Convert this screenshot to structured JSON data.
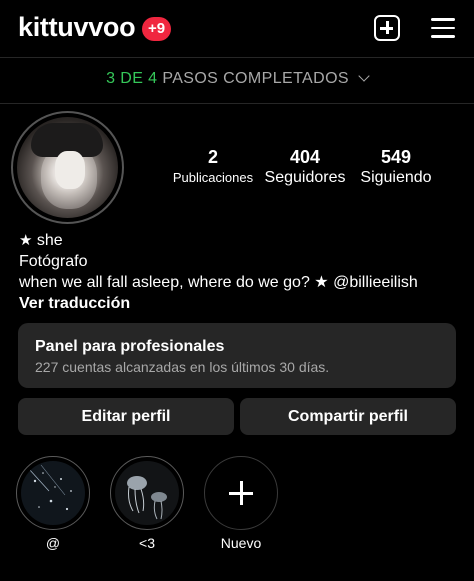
{
  "header": {
    "username": "kittuvvoo",
    "notification_badge": "+9",
    "create_icon": "plus-square-icon",
    "menu_icon": "hamburger-menu-icon",
    "badge_color": "#f0263f"
  },
  "steps": {
    "done": "3 DE 4",
    "label": "PASOS COMPLETADOS",
    "accent_color": "#35c759"
  },
  "stats": [
    {
      "value": "2",
      "label": "Publicaciones"
    },
    {
      "value": "404",
      "label": "Seguidores"
    },
    {
      "value": "549",
      "label": "Siguiendo"
    }
  ],
  "bio": {
    "pronouns": "she",
    "category": "Fotógrafo",
    "text": "when we all fall asleep, where do we go? ★ @billieeilish",
    "translate": "Ver traducción"
  },
  "panel": {
    "title": "Panel para profesionales",
    "subtitle": "227 cuentas alcanzadas en los últimos 30 días."
  },
  "buttons": {
    "edit": "Editar perfil",
    "share": "Compartir perfil"
  },
  "highlights": [
    {
      "label": "@"
    },
    {
      "label": "<3"
    },
    {
      "label": "Nuevo"
    }
  ]
}
